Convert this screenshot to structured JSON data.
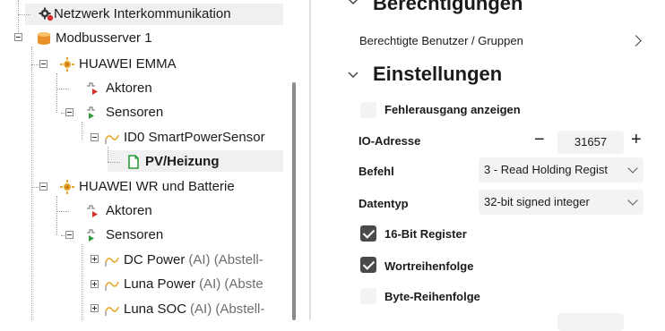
{
  "tree": {
    "items": [
      {
        "label": "Netzwerk Interkommunikation",
        "icon": "gear-alert-icon"
      },
      {
        "label": "Modbusserver 1",
        "icon": "database-icon"
      },
      {
        "label": "HUAWEI EMMA",
        "icon": "device-sun-icon"
      },
      {
        "label": "Aktoren",
        "icon": "actuator-icon"
      },
      {
        "label": "Sensoren",
        "icon": "sensor-icon"
      },
      {
        "label": "ID0 SmartPowerSensor",
        "icon": "sensor-wave-icon"
      },
      {
        "label": "PV/Heizung",
        "icon": "document-icon"
      },
      {
        "label": "HUAWEI WR und Batterie",
        "icon": "device-sun-icon"
      },
      {
        "label": "Aktoren",
        "icon": "actuator-icon"
      },
      {
        "label": "Sensoren",
        "icon": "sensor-icon"
      },
      {
        "label": "DC Power",
        "suffix": "(AI) (Abstell-",
        "icon": "sensor-wave-icon"
      },
      {
        "label": "Luna Power",
        "suffix": "(AI) (Abste",
        "icon": "sensor-wave-icon"
      },
      {
        "label": "Luna SOC",
        "suffix": "(AI) (Abstell-",
        "icon": "sensor-wave-icon"
      }
    ]
  },
  "props": {
    "berechtigungen": {
      "title": "Berechtigungen",
      "row_label": "Berechtigte Benutzer / Gruppen"
    },
    "einstellungen": {
      "title": "Einstellungen",
      "fehlerausgang": {
        "label": "Fehlerausgang anzeigen",
        "checked": false
      },
      "io_adresse": {
        "label": "IO-Adresse",
        "value": "31657",
        "minus": "−",
        "plus": "+"
      },
      "befehl": {
        "label": "Befehl",
        "value": "3 - Read Holding Regist"
      },
      "datentyp": {
        "label": "Datentyp",
        "value": "32-bit signed integer"
      },
      "bit16": {
        "label": "16-Bit Register",
        "checked": true
      },
      "wortreihenfolge": {
        "label": "Wortreihenfolge",
        "checked": true
      },
      "bytereihenfolge": {
        "label": "Byte-Reihenfolge",
        "checked": false
      }
    }
  },
  "colors": {
    "accent_red": "#d9302c",
    "db_orange": "#e8912a",
    "sun_yellow": "#e6a82a",
    "sensor_green": "#2e9a3c",
    "checkbox_on": "#4a4a4a"
  }
}
